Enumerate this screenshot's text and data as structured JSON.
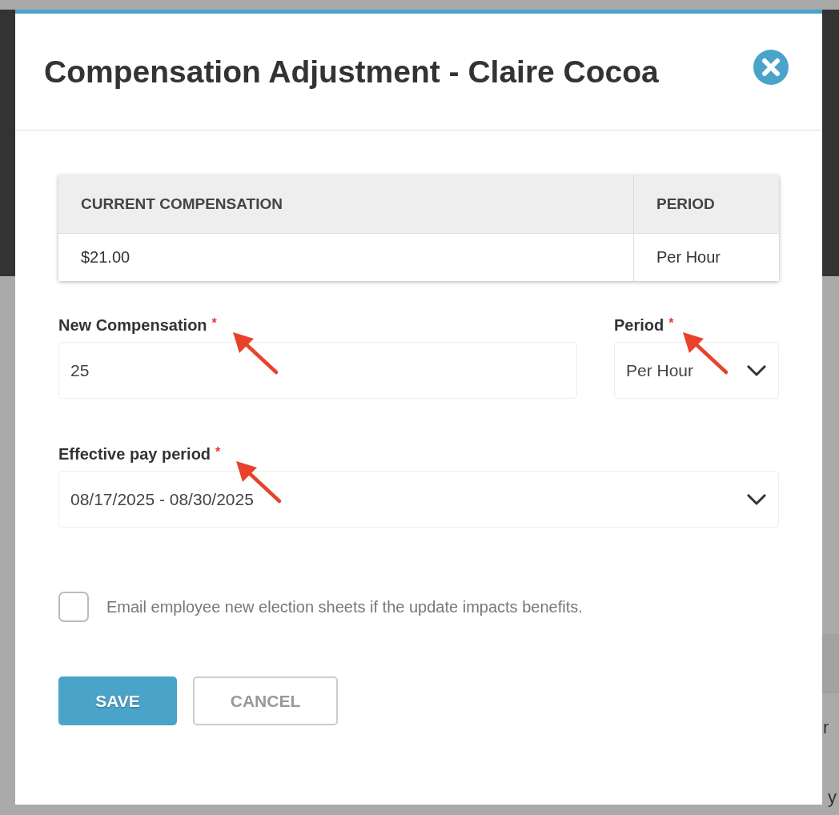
{
  "dialog": {
    "title": "Compensation Adjustment - Claire Cocoa"
  },
  "current_table": {
    "columns": [
      "CURRENT COMPENSATION",
      "PERIOD"
    ],
    "rows": [
      [
        "$21.00",
        "Per Hour"
      ]
    ]
  },
  "fields": [
    {
      "kind": "input",
      "label": "New Compensation",
      "required_mark": "*",
      "value": "25"
    },
    {
      "kind": "select",
      "label": "Period",
      "required_mark": "*",
      "value": "Per Hour"
    },
    {
      "kind": "select",
      "label": "Effective pay period",
      "required_mark": "*",
      "value": "08/17/2025 - 08/30/2025"
    }
  ],
  "email_option": {
    "label": "Email employee new election sheets if the update impacts benefits.",
    "checked": false
  },
  "buttons": [
    {
      "label": "SAVE",
      "kind": "primary"
    },
    {
      "label": "CANCEL",
      "kind": "secondary"
    }
  ],
  "background_fragments": [
    "r",
    "y"
  ]
}
